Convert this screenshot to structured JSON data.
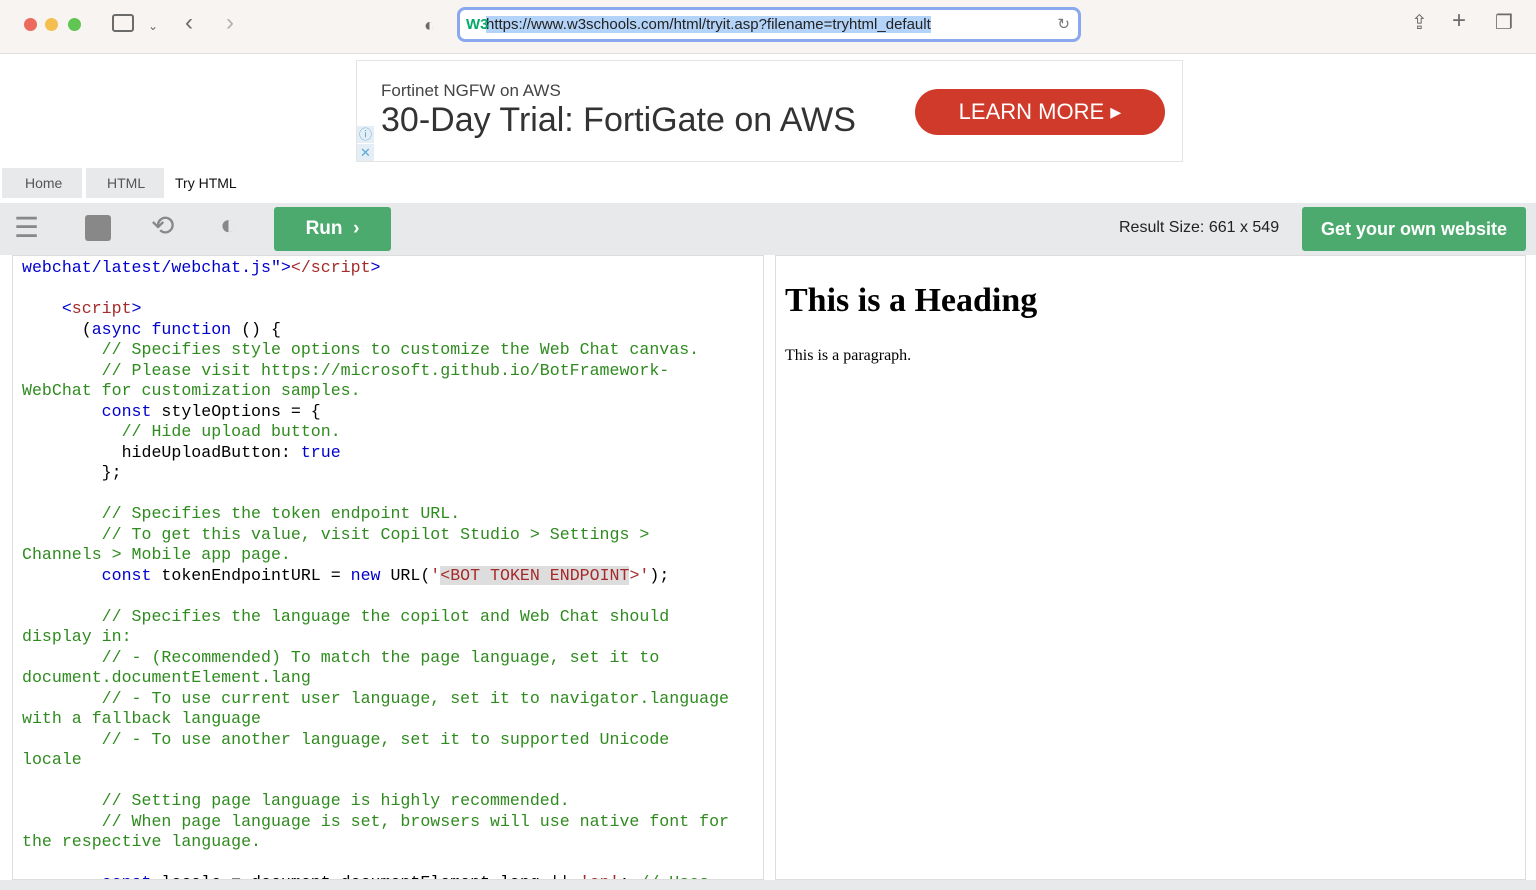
{
  "browser": {
    "url": "https://www.w3schools.com/html/tryit.asp?filename=tryhtml_default",
    "favicon": "W3"
  },
  "ad": {
    "subtitle": "Fortinet NGFW on AWS",
    "headline": "30-Day Trial: FortiGate on AWS",
    "cta": "LEARN MORE"
  },
  "breadcrumb": [
    "Home",
    "HTML",
    "Try HTML"
  ],
  "toolbar": {
    "run": "Run",
    "result_size": "Result Size: 661 x 549",
    "own_site": "Get your own website"
  },
  "editor": {
    "lines": [
      [
        [
          "kw",
          "webchat/latest/webchat.js\""
        ],
        [
          "kw",
          ">"
        ],
        [
          "tag",
          "</script"
        ],
        [
          "kw",
          ">"
        ]
      ],
      [],
      [
        [
          "kw",
          "    <"
        ],
        [
          "tag",
          "script"
        ],
        [
          "kw",
          ">"
        ]
      ],
      [
        [
          "plain",
          "      ("
        ],
        [
          "kw",
          "async function"
        ],
        [
          "plain",
          " () {"
        ]
      ],
      [
        [
          "com",
          "        // Specifies style options to customize the Web Chat canvas."
        ]
      ],
      [
        [
          "com",
          "        // Please visit https://microsoft.github.io/BotFramework-"
        ]
      ],
      [
        [
          "com",
          "WebChat for customization samples."
        ]
      ],
      [
        [
          "kw",
          "        const"
        ],
        [
          "plain",
          " styleOptions = {"
        ]
      ],
      [
        [
          "com",
          "          // Hide upload button."
        ]
      ],
      [
        [
          "plain",
          "          hideUploadButton: "
        ],
        [
          "kw",
          "true"
        ]
      ],
      [
        [
          "plain",
          "        };"
        ]
      ],
      [],
      [
        [
          "com",
          "        // Specifies the token endpoint URL."
        ]
      ],
      [
        [
          "com",
          "        // To get this value, visit Copilot Studio > Settings >"
        ]
      ],
      [
        [
          "com",
          "Channels > Mobile app page."
        ]
      ],
      [
        [
          "kw",
          "        const"
        ],
        [
          "plain",
          " tokenEndpointURL = "
        ],
        [
          "kw",
          "new"
        ],
        [
          "plain",
          " URL("
        ],
        [
          "str",
          "'"
        ],
        [
          "hl",
          "<BOT TOKEN ENDPOINT"
        ],
        [
          "str",
          ">'"
        ],
        [
          "plain",
          ");"
        ]
      ],
      [],
      [
        [
          "com",
          "        // Specifies the language the copilot and Web Chat should"
        ]
      ],
      [
        [
          "com",
          "display in:"
        ]
      ],
      [
        [
          "com",
          "        // - (Recommended) To match the page language, set it to"
        ]
      ],
      [
        [
          "com",
          "document.documentElement.lang"
        ]
      ],
      [
        [
          "com",
          "        // - To use current user language, set it to navigator.language"
        ]
      ],
      [
        [
          "com",
          "with a fallback language"
        ]
      ],
      [
        [
          "com",
          "        // - To use another language, set it to supported Unicode"
        ]
      ],
      [
        [
          "com",
          "locale"
        ]
      ],
      [],
      [
        [
          "com",
          "        // Setting page language is highly recommended."
        ]
      ],
      [
        [
          "com",
          "        // When page language is set, browsers will use native font for"
        ]
      ],
      [
        [
          "com",
          "the respective language."
        ]
      ],
      [],
      [
        [
          "kw",
          "        const"
        ],
        [
          "plain",
          " locale = document.documentElement.lang || "
        ],
        [
          "str",
          "'en'"
        ],
        [
          "plain",
          "; "
        ],
        [
          "com",
          "// Uses"
        ]
      ]
    ]
  },
  "result": {
    "heading": "This is a Heading",
    "paragraph": "This is a paragraph."
  }
}
